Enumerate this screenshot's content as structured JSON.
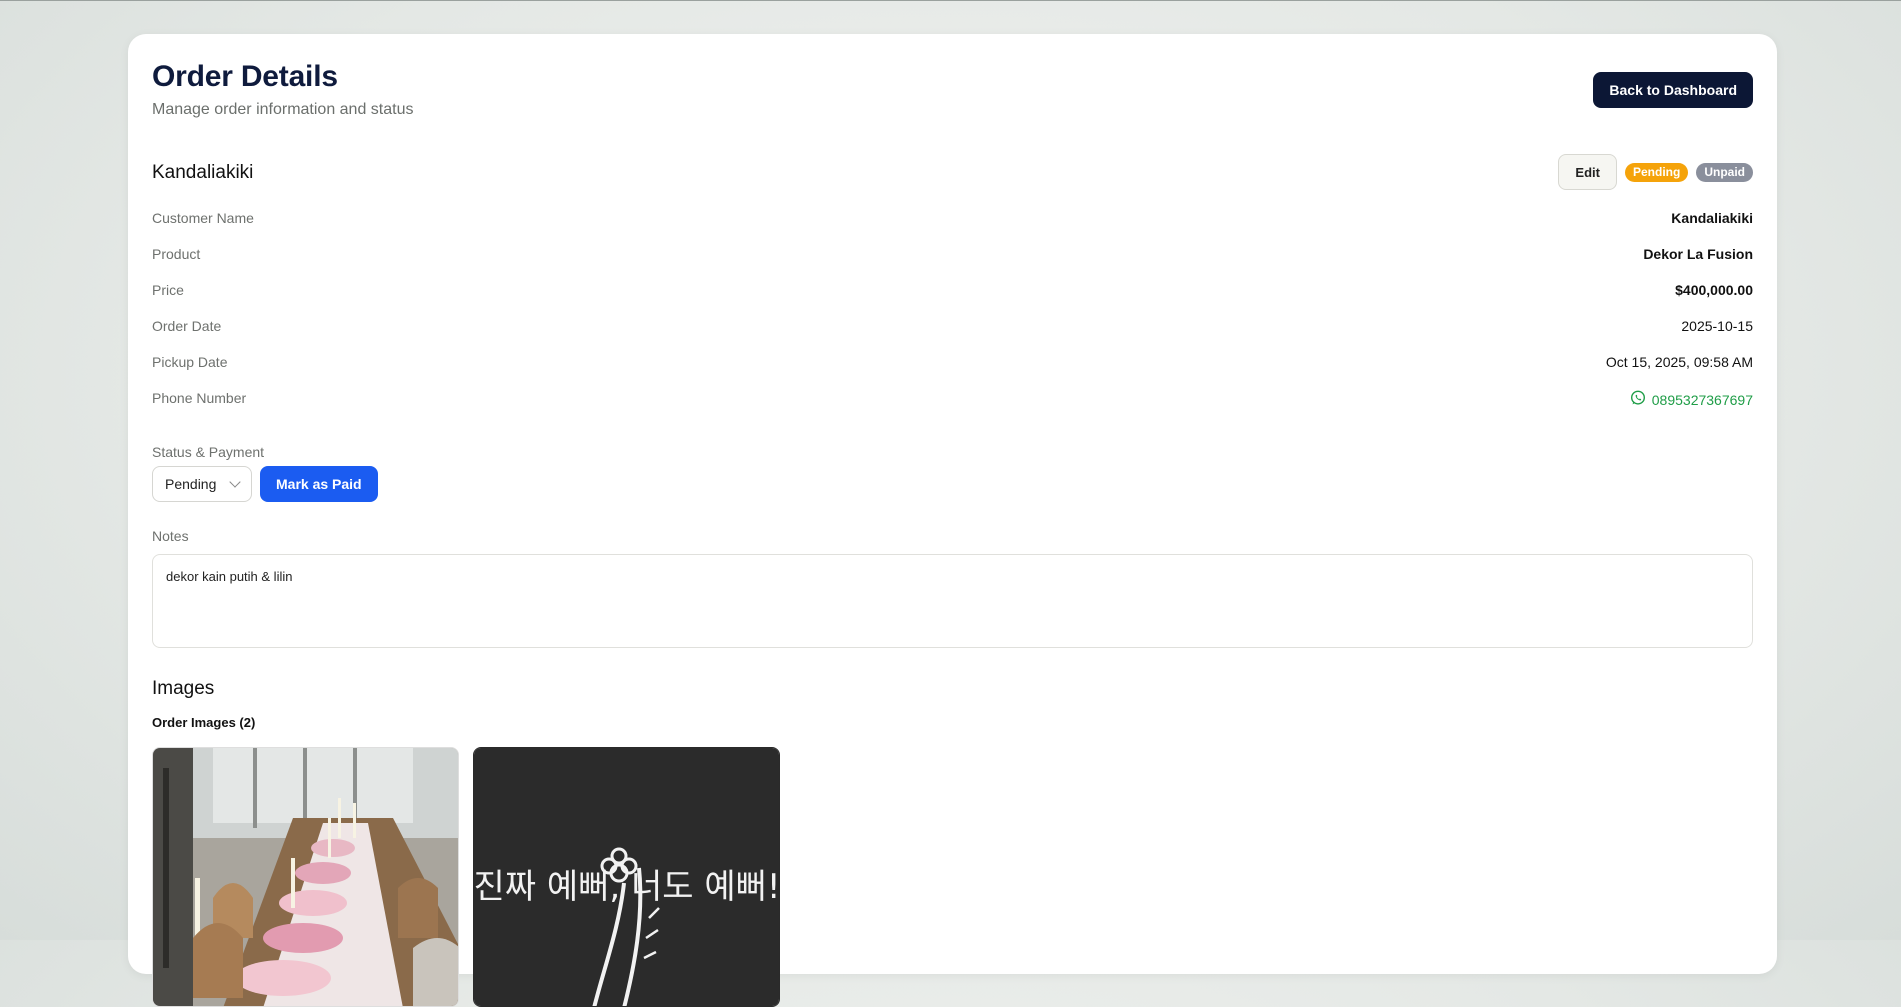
{
  "header": {
    "title": "Order Details",
    "subtitle": "Manage order information and status",
    "back_label": "Back to Dashboard"
  },
  "order": {
    "name": "Kandaliakiki",
    "edit_label": "Edit",
    "status_badge": "Pending",
    "payment_badge": "Unpaid",
    "status_color": "#f5a30a",
    "payment_color": "#8a8f9c"
  },
  "details": [
    {
      "label": "Customer Name",
      "value": "Kandaliakiki"
    },
    {
      "label": "Product",
      "value": "Dekor La Fusion"
    },
    {
      "label": "Price",
      "value": "$400,000.00"
    },
    {
      "label": "Order Date",
      "value": "2025-10-15"
    },
    {
      "label": "Pickup Date",
      "value": "Oct 15, 2025, 09:58 AM"
    },
    {
      "label": "Phone Number",
      "value": "0895327367697"
    }
  ],
  "status_payment": {
    "label": "Status & Payment",
    "selected_status": "Pending",
    "mark_paid_label": "Mark as Paid",
    "accent_color": "#1b5cf1"
  },
  "notes": {
    "label": "Notes",
    "value": "dekor kain putih & lilin"
  },
  "images": {
    "title": "Images",
    "order_images_label": "Order Images (2)",
    "items": [
      {
        "alt": "table-decor-photo"
      },
      {
        "alt": "flower-lettering-photo",
        "lettering": "진짜 예뻐, 너도 예뻐!"
      }
    ]
  }
}
